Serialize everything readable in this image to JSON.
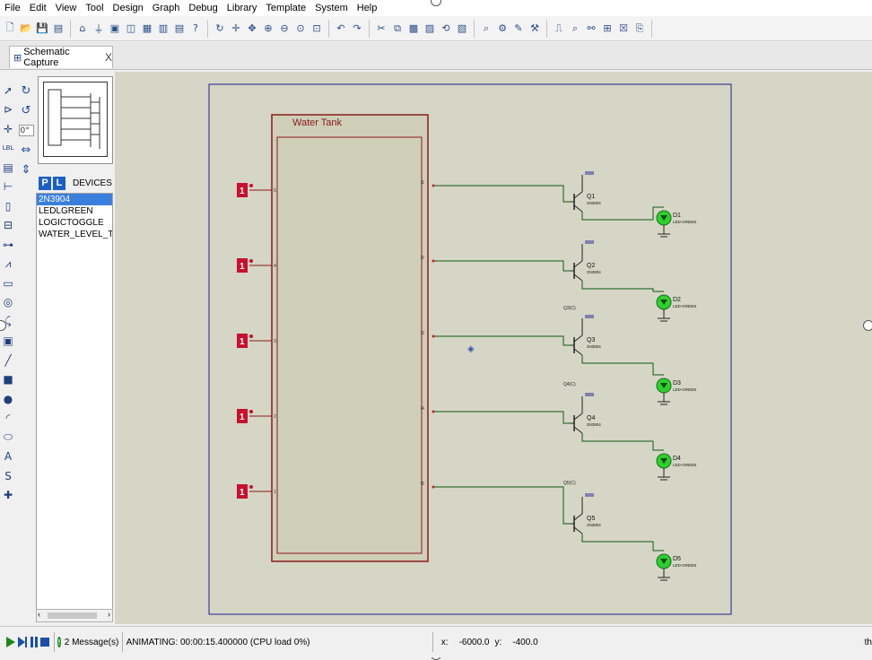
{
  "menu": [
    "File",
    "Edit",
    "View",
    "Tool",
    "Design",
    "Graph",
    "Debug",
    "Library",
    "Template",
    "System",
    "Help"
  ],
  "toolbar_icons": [
    "new-icon",
    "open-icon",
    "save-icon",
    "save-all-icon",
    "home-icon",
    "component-icon",
    "chip-icon",
    "package-icon",
    "grid-icon",
    "bom-icon",
    "notes-icon",
    "help-icon",
    "refresh-icon",
    "origin-icon",
    "pan-icon",
    "zoom-in-icon",
    "zoom-out-icon",
    "zoom-all-icon",
    "zoom-area-icon",
    "undo-icon",
    "redo-icon",
    "cut-icon",
    "copy-icon",
    "block-copy-icon",
    "block-move-icon",
    "block-rotate-icon",
    "block-delete-icon",
    "pick-icon",
    "make-device-icon",
    "packaging-icon",
    "decompose-icon",
    "wire-autorouter-icon",
    "search-icon",
    "property-tool-icon",
    "netlist-icon",
    "erc-icon",
    "export-icon"
  ],
  "tab": {
    "label": "Schematic Capture",
    "close": "X"
  },
  "left_tools": [
    "select-icon",
    "component-icon",
    "junction-icon",
    "label-icon",
    "text-icon",
    "bus-icon",
    "subcircuit-icon",
    "terminal-icon",
    "pin-icon",
    "graph-icon",
    "tape-icon",
    "generator-icon",
    "probe-icon",
    "instrument-icon",
    "line-icon",
    "box-icon",
    "circle-icon",
    "arc-icon",
    "path-icon",
    "text-tool-icon",
    "symbol-icon",
    "marker-icon"
  ],
  "rotation": {
    "angle": "0°"
  },
  "devices": {
    "p_label": "P",
    "l_label": "L",
    "title": "DEVICES",
    "items": [
      "2N3904",
      "LEDLGREEN",
      "LOGICTOGGLE",
      "WATER_LEVEL_TANK"
    ],
    "selected_index": 0
  },
  "schematic": {
    "tank_label": "Water Tank",
    "toggle_value": "1",
    "toggle_pins": [
      "5",
      "4",
      "3",
      "2",
      "1"
    ],
    "output_pins": [
      "l1",
      "l2",
      "l3",
      "l4",
      "l5"
    ],
    "transistors": [
      {
        "ref": "Q1",
        "part": "2N3904"
      },
      {
        "ref": "Q2",
        "part": "2N3904"
      },
      {
        "ref": "Q3",
        "part": "2N3904"
      },
      {
        "ref": "Q4",
        "part": "2N3904"
      },
      {
        "ref": "Q5",
        "part": "2N3904"
      }
    ],
    "leds": [
      {
        "ref": "D1",
        "part": "LED-GREEN"
      },
      {
        "ref": "D2",
        "part": "LED-GREEN"
      },
      {
        "ref": "D3",
        "part": "LED-GREEN"
      },
      {
        "ref": "D4",
        "part": "LED-GREEN"
      },
      {
        "ref": "D5",
        "part": "LED-GREEN"
      }
    ],
    "power_labels": [
      "Q3(C)",
      "Q4(C)",
      "Q5(C)"
    ],
    "colors": {
      "grid_bg": "#d6d6c6",
      "grid_line": "#c2c2b1",
      "frame": "#1f1f8c",
      "tank_border": "#8b1a1a",
      "tank_fill": "#cfcfb8",
      "wire": "#0f5a0f",
      "led_green": "#2ed02e",
      "toggle_red": "#c8102e"
    }
  },
  "status": {
    "messages": "2 Message(s)",
    "animating": "ANIMATING: 00:00:15.400000 (CPU load 0%)",
    "x_label": "x:",
    "x_value": "-6000.0",
    "y_label": "y:",
    "y_value": "-400.0",
    "th": "th"
  }
}
